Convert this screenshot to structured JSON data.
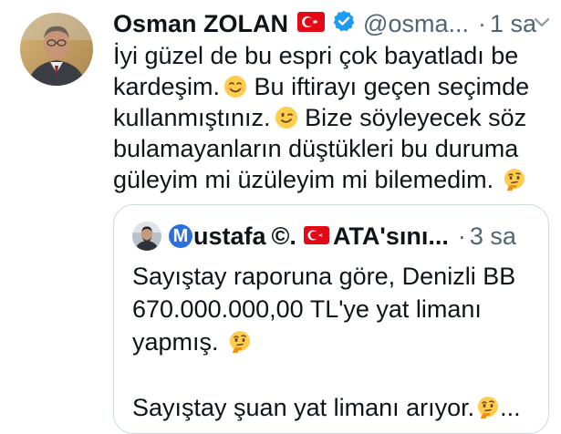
{
  "tweet": {
    "author_name": "Osman ZOLAN",
    "handle": "@osma...",
    "separator": "·",
    "time": "1 sa",
    "text_lines": [
      "İyi güzel de bu espri çok bayatladı be",
      "kardeşim.",
      "Bu iftirayı geçen seçimde",
      "kullanmıştınız.",
      "Bize söyleyecek söz",
      "bulamayanların düştükleri bu duruma",
      "güleyim mi üzüleyim mi bilemedim."
    ]
  },
  "quote": {
    "badge_letter": "M",
    "author_name": "ustafa",
    "copyright": "©.",
    "name_suffix": "ATA'sını...",
    "separator": "·",
    "time": "3 sa",
    "text_lines": [
      "Sayıştay raporuna göre, Denizli BB",
      "670.000.000,00 TL'ye yat limanı",
      "yapmış.",
      "Sayıştay şuan yat limanı arıyor.",
      "..."
    ]
  },
  "colors": {
    "text": "#0f1419",
    "secondary": "#536471",
    "verified": "#1d9bf0",
    "flag_red": "#e30a17",
    "quote_border": "#cfd9de",
    "badge_blue": "#2f6fdc"
  },
  "icons": {
    "flag": "turkey-flag-icon",
    "verified": "verified-badge-icon",
    "more": "more-options-icon",
    "smiling": "smiling-face-icon",
    "winking": "winking-face-icon",
    "thinking": "thinking-face-icon"
  }
}
